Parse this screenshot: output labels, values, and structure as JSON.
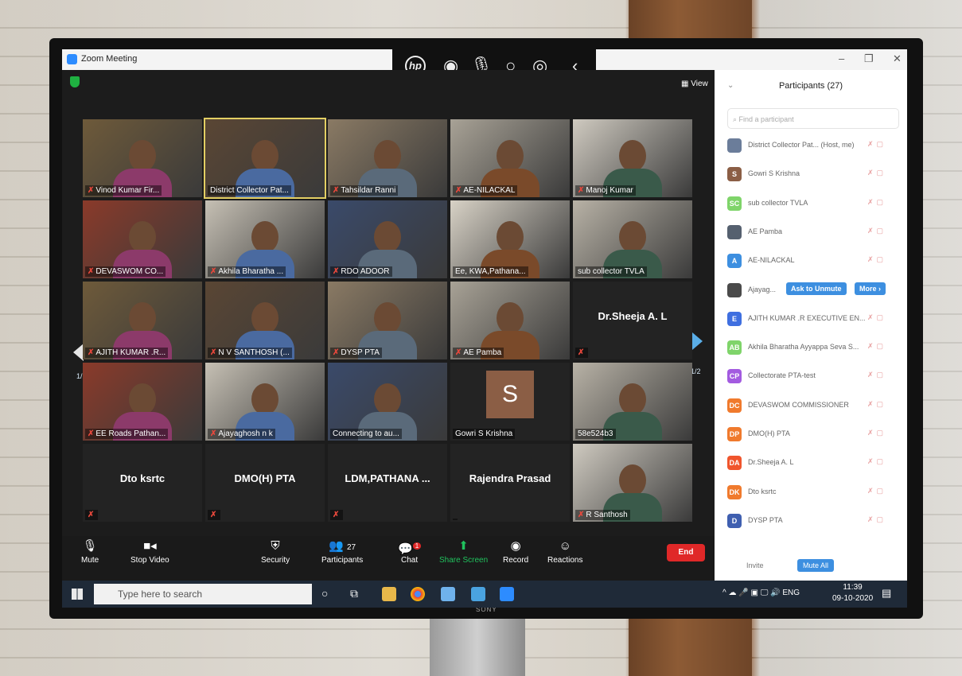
{
  "window": {
    "title": "Zoom Meeting",
    "minimize": "–",
    "restore": "❐",
    "close": "✕"
  },
  "hp_bar": {
    "logo": "hp",
    "icons": [
      "camera-dot-icon",
      "mic-icon",
      "camera-dot-icon",
      "touch-icon",
      "back-chevron-icon"
    ]
  },
  "view_label": "View",
  "pager": {
    "left": "1/2",
    "right": "1/2"
  },
  "tiles": [
    {
      "name": "Vinod Kumar Fir...",
      "muted": true,
      "video": true
    },
    {
      "name": "District Collector Pat...",
      "muted": false,
      "video": true,
      "highlight": true
    },
    {
      "name": "Tahsildar Ranni",
      "muted": true,
      "video": true
    },
    {
      "name": "AE-NILACKAL",
      "muted": true,
      "video": true
    },
    {
      "name": "Manoj Kumar",
      "muted": true,
      "video": true
    },
    {
      "name": "DEVASWOM CO...",
      "muted": true,
      "video": true
    },
    {
      "name": "Akhila Bharatha ...",
      "muted": true,
      "video": true
    },
    {
      "name": "RDO ADOOR",
      "muted": true,
      "video": true
    },
    {
      "name": "Ee, KWA,Pathana...",
      "muted": false,
      "video": true
    },
    {
      "name": "sub collector TVLA",
      "muted": false,
      "video": true
    },
    {
      "name": "AJITH KUMAR .R...",
      "muted": true,
      "video": true
    },
    {
      "name": "N V SANTHOSH (...",
      "muted": true,
      "video": true
    },
    {
      "name": "DYSP PTA",
      "muted": true,
      "video": true
    },
    {
      "name": "AE Pamba",
      "muted": true,
      "video": true
    },
    {
      "name": "Dr.Sheeja A. L",
      "muted": true,
      "video": false
    },
    {
      "name": "EE Roads Pathan...",
      "muted": true,
      "video": true
    },
    {
      "name": "Ajayaghosh n k",
      "muted": true,
      "video": true
    },
    {
      "name": "Connecting to au...",
      "muted": false,
      "video": true
    },
    {
      "name": "Gowri S Krishna",
      "muted": false,
      "video": false,
      "avatar": "S"
    },
    {
      "name": "58e524b3",
      "muted": false,
      "video": true
    },
    {
      "name": "Dto ksrtc",
      "muted": true,
      "video": false
    },
    {
      "name": "DMO(H) PTA",
      "muted": true,
      "video": false
    },
    {
      "name": "LDM,PATHANA ...",
      "muted": true,
      "video": false
    },
    {
      "name": "Rajendra Prasad",
      "muted": false,
      "video": false
    },
    {
      "name": "R Santhosh",
      "muted": true,
      "video": true
    }
  ],
  "toolbar": {
    "mute": "Mute",
    "stop_video": "Stop Video",
    "security": "Security",
    "participants": "Participants",
    "participants_count": "27",
    "chat": "Chat",
    "chat_badge": "1",
    "share_screen": "Share Screen",
    "record": "Record",
    "reactions": "Reactions",
    "end": "End"
  },
  "participants_panel": {
    "header": "Participants (27)",
    "search_placeholder": "Find a participant",
    "rows": [
      {
        "initials": "",
        "name": "District Collector Pat...  (Host, me)",
        "color": "#6b7d9a"
      },
      {
        "initials": "S",
        "name": "Gowri S Krishna",
        "color": "#8b5e45"
      },
      {
        "initials": "SC",
        "name": "sub collector TVLA",
        "color": "#7fd46a"
      },
      {
        "initials": "",
        "name": "AE Pamba",
        "color": "#55606f"
      },
      {
        "initials": "A",
        "name": "AE-NILACKAL",
        "color": "#3d8fe0"
      },
      {
        "initials": "",
        "name": "Ajayag...",
        "color": "#4a4a4a",
        "hover": true
      },
      {
        "initials": "E",
        "name": "AJITH KUMAR .R EXECUTIVE EN...",
        "color": "#3f6fe0"
      },
      {
        "initials": "AB",
        "name": "Akhila Bharatha Ayyappa Seva S...",
        "color": "#7fd46a"
      },
      {
        "initials": "CP",
        "name": "Collectorate PTA-test",
        "color": "#a35be0"
      },
      {
        "initials": "DC",
        "name": "DEVASWOM COMMISSIONER",
        "color": "#f07a2d"
      },
      {
        "initials": "DP",
        "name": "DMO(H) PTA",
        "color": "#f07a2d"
      },
      {
        "initials": "DA",
        "name": "Dr.Sheeja A. L",
        "color": "#f0552d"
      },
      {
        "initials": "DK",
        "name": "Dto ksrtc",
        "color": "#f07a2d"
      },
      {
        "initials": "D",
        "name": "DYSP PTA",
        "color": "#3f5fb0"
      }
    ],
    "ask_unmute": "Ask to Unmute",
    "more": "More ›",
    "invite": "Invite",
    "mute_all": "Mute All"
  },
  "taskbar": {
    "search_placeholder": "Type here to search",
    "tray": "^ ☁ 🎤 ▣ 🖵 🔊 ENG",
    "time": "11:39",
    "date": "09-10-2020"
  },
  "brand": "SONY"
}
